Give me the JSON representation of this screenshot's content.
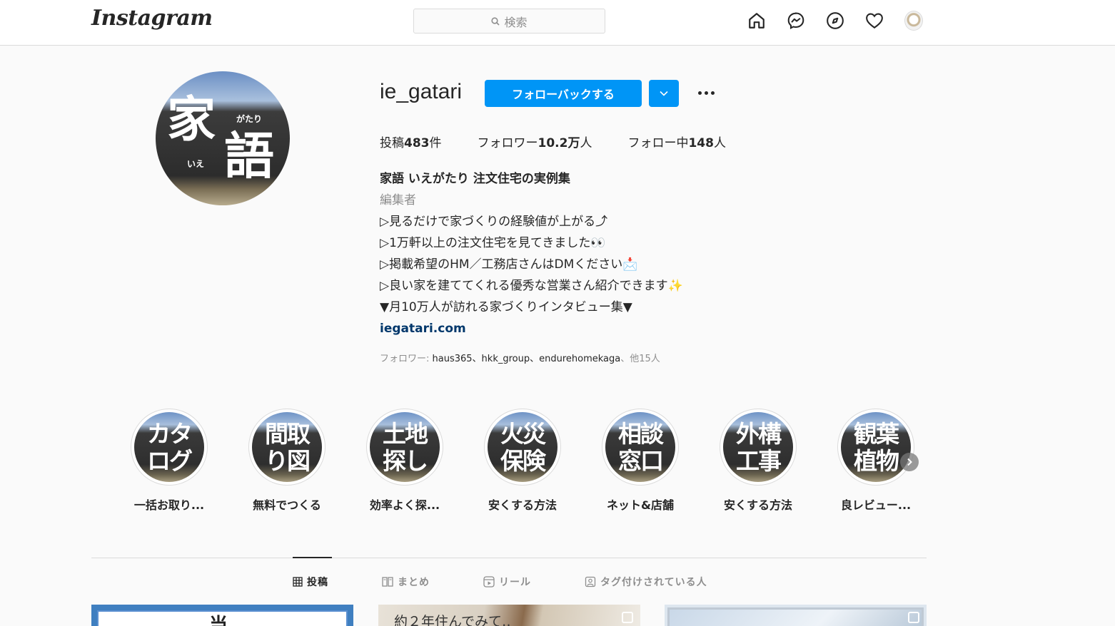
{
  "topbar": {
    "logo": "Instagram",
    "search_placeholder": "検索",
    "icons": [
      "home-icon",
      "messenger-icon",
      "explore-icon",
      "heart-icon",
      "profile-avatar"
    ]
  },
  "profile": {
    "username": "ie_gatari",
    "follow_button": "フォローバックする",
    "avatar_text": {
      "big1": "家",
      "big2": "語",
      "ruby1": "がたり",
      "ruby2": "いえ"
    },
    "stats": [
      {
        "label": "投稿",
        "value": "483",
        "suffix": "件"
      },
      {
        "label": "フォロワー",
        "value": "10.2万",
        "suffix": "人"
      },
      {
        "label": "フォロー中",
        "value": "148",
        "suffix": "人"
      }
    ],
    "bio": {
      "name": "家語 いえがたり 注文住宅の実例集",
      "category": "編集者",
      "lines": [
        "▷見るだけで家づくりの経験値が上がる⤴︎",
        "▷1万軒以上の注文住宅を見てきました👀",
        "▷掲載希望のHM／工務店さんはDMください📩",
        "▷良い家を建ててくれる優秀な営業さん紹介できます✨",
        "▼月10万人が訪れる家づくりインタビュー集▼"
      ],
      "link": "iegatari.com"
    },
    "followed_by": {
      "prefix": "フォロワー: ",
      "users": "haus365、hkk_group、endurehomekaga",
      "suffix": "、他15人"
    }
  },
  "highlights": [
    {
      "cover": "カタ\nログ",
      "label": "一括お取り..."
    },
    {
      "cover": "間取\nり図",
      "label": "無料でつくる"
    },
    {
      "cover": "土地\n探し",
      "label": "効率よく探..."
    },
    {
      "cover": "火災\n保険",
      "label": "安くする方法"
    },
    {
      "cover": "相談\n窓口",
      "label": "ネット&店舗"
    },
    {
      "cover": "外構\n工事",
      "label": "安くする方法"
    },
    {
      "cover": "観葉\n植物",
      "label": "良レビュー..."
    }
  ],
  "tabs": [
    {
      "label": "投稿",
      "active": true,
      "icon": "grid-icon"
    },
    {
      "label": "まとめ",
      "active": false,
      "icon": "guide-icon"
    },
    {
      "label": "リール",
      "active": false,
      "icon": "reels-icon"
    },
    {
      "label": "タグ付けされている人",
      "active": false,
      "icon": "tagged-icon"
    }
  ],
  "posts": [
    {
      "text": "当"
    },
    {
      "text": "約２年住んでみて‥"
    },
    {
      "text": ""
    }
  ],
  "colors": {
    "accent": "#0095f6",
    "link": "#00376b",
    "muted": "#8e8e8e"
  }
}
